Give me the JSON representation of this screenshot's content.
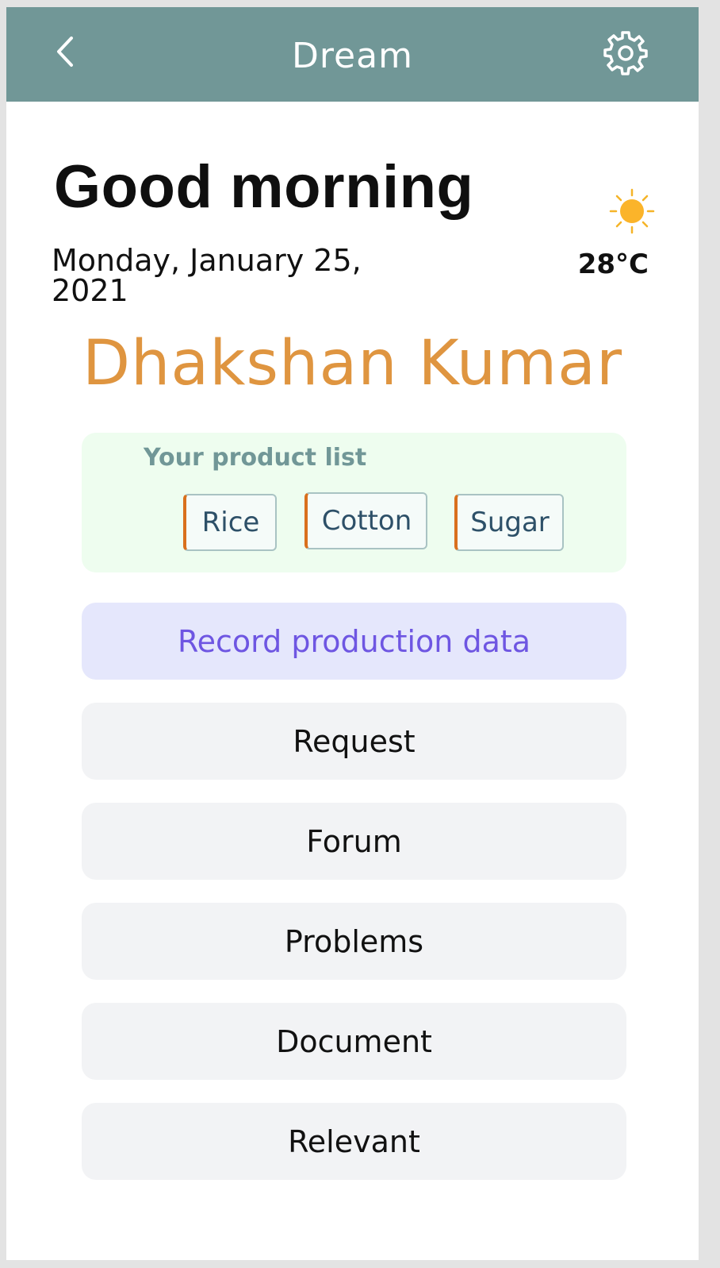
{
  "app_bar": {
    "title": "Dream",
    "back_icon": "chevron-left-icon",
    "settings_icon": "gear-icon",
    "background": "#719797"
  },
  "header": {
    "greeting": "Good morning",
    "date": "Monday, January 25, 2021",
    "weather_icon": "sun-icon",
    "temperature": "28°C"
  },
  "user": {
    "name": "Dhakshan Kumar",
    "color": "#df9540"
  },
  "product_list": {
    "title": "Your product list",
    "items": [
      "Rice",
      "Cotton",
      "Sugar"
    ]
  },
  "menu": {
    "record_production": "Record production data",
    "request": "Request",
    "forum": "Forum",
    "problems": "Problems",
    "document": "Document",
    "relevant": "Relevant"
  },
  "colors": {
    "accent": "#6e56e2",
    "chip_accent": "#d9701d",
    "card_bg": "#eefdef"
  }
}
